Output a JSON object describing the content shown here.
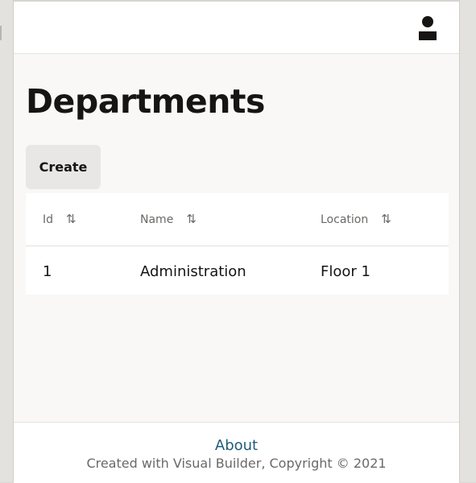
{
  "header": {
    "avatar_icon": "user-avatar-icon"
  },
  "page": {
    "title": "Departments",
    "create_label": "Create"
  },
  "table": {
    "columns": [
      {
        "label": "Id",
        "sort_icon": "sort-icon"
      },
      {
        "label": "Name",
        "sort_icon": "sort-icon"
      },
      {
        "label": "Location",
        "sort_icon": "sort-icon"
      }
    ],
    "sort_glyph": "⇅",
    "rows": [
      {
        "id": "1",
        "name": "Administration",
        "location": "Floor 1"
      }
    ]
  },
  "footer": {
    "about_label": "About",
    "copyright": "Created with Visual Builder, Copyright © 2021"
  },
  "colors": {
    "link": "#1f5d7a",
    "text": "#161513",
    "button_bg": "#e8e7e5",
    "page_bg": "#f9f8f6"
  }
}
